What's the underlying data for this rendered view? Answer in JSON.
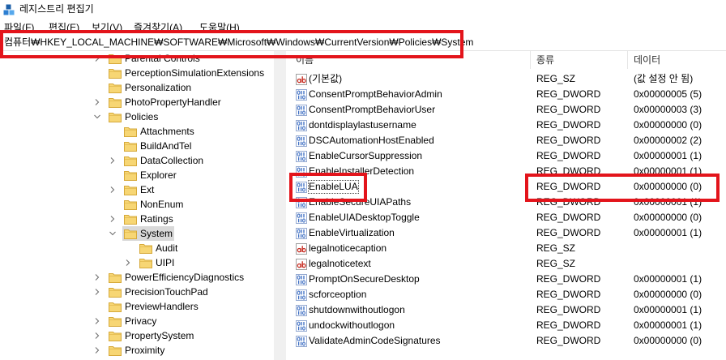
{
  "window": {
    "title": "레지스트리 편집기",
    "icon": "regedit-icon"
  },
  "menu": {
    "items": [
      "파일(F)",
      "편집(E)",
      "보기(V)",
      "즐겨찾기(A)",
      "도움말(H)"
    ]
  },
  "address_bar": {
    "path": "컴퓨터₩HKEY_LOCAL_MACHINE₩SOFTWARE₩Microsoft₩Windows₩CurrentVersion₩Policies₩System"
  },
  "tree": {
    "items": [
      {
        "label": "Parental Controls",
        "expandable": true
      },
      {
        "label": "PerceptionSimulationExtensions"
      },
      {
        "label": "Personalization"
      },
      {
        "label": "PhotoPropertyHandler",
        "expandable": true
      },
      {
        "label": "Policies",
        "expandable": true,
        "expanded": true,
        "children": [
          {
            "label": "Attachments"
          },
          {
            "label": "BuildAndTel"
          },
          {
            "label": "DataCollection",
            "expandable": true
          },
          {
            "label": "Explorer"
          },
          {
            "label": "Ext",
            "expandable": true
          },
          {
            "label": "NonEnum"
          },
          {
            "label": "Ratings",
            "expandable": true
          },
          {
            "label": "System",
            "expandable": true,
            "expanded": true,
            "selected": true,
            "children": [
              {
                "label": "Audit"
              },
              {
                "label": "UIPI",
                "expandable": true
              }
            ]
          }
        ]
      },
      {
        "label": "PowerEfficiencyDiagnostics",
        "expandable": true
      },
      {
        "label": "PrecisionTouchPad",
        "expandable": true
      },
      {
        "label": "PreviewHandlers"
      },
      {
        "label": "Privacy",
        "expandable": true
      },
      {
        "label": "PropertySystem",
        "expandable": true
      },
      {
        "label": "Proximity",
        "expandable": true
      }
    ]
  },
  "values_list": {
    "columns": {
      "name": "이름",
      "type": "종류",
      "data": "데이터"
    },
    "rows": [
      {
        "name": "(기본값)",
        "type": "REG_SZ",
        "data": "(값 설정 안 됨)",
        "icon": "string-value-icon"
      },
      {
        "name": "ConsentPromptBehaviorAdmin",
        "type": "REG_DWORD",
        "data": "0x00000005 (5)",
        "icon": "dword-value-icon"
      },
      {
        "name": "ConsentPromptBehaviorUser",
        "type": "REG_DWORD",
        "data": "0x00000003 (3)",
        "icon": "dword-value-icon"
      },
      {
        "name": "dontdisplaylastusername",
        "type": "REG_DWORD",
        "data": "0x00000000 (0)",
        "icon": "dword-value-icon"
      },
      {
        "name": "DSCAutomationHostEnabled",
        "type": "REG_DWORD",
        "data": "0x00000002 (2)",
        "icon": "dword-value-icon"
      },
      {
        "name": "EnableCursorSuppression",
        "type": "REG_DWORD",
        "data": "0x00000001 (1)",
        "icon": "dword-value-icon"
      },
      {
        "name": "EnableInstallerDetection",
        "type": "REG_DWORD",
        "data": "0x00000001 (1)",
        "icon": "dword-value-icon"
      },
      {
        "name": "EnableLUA",
        "type": "REG_DWORD",
        "data": "0x00000000 (0)",
        "icon": "dword-value-icon",
        "focused": true
      },
      {
        "name": "EnableSecureUIAPaths",
        "type": "REG_DWORD",
        "data": "0x00000001 (1)",
        "icon": "dword-value-icon"
      },
      {
        "name": "EnableUIADesktopToggle",
        "type": "REG_DWORD",
        "data": "0x00000000 (0)",
        "icon": "dword-value-icon"
      },
      {
        "name": "EnableVirtualization",
        "type": "REG_DWORD",
        "data": "0x00000001 (1)",
        "icon": "dword-value-icon"
      },
      {
        "name": "legalnoticecaption",
        "type": "REG_SZ",
        "data": "",
        "icon": "string-value-icon"
      },
      {
        "name": "legalnoticetext",
        "type": "REG_SZ",
        "data": "",
        "icon": "string-value-icon"
      },
      {
        "name": "PromptOnSecureDesktop",
        "type": "REG_DWORD",
        "data": "0x00000001 (1)",
        "icon": "dword-value-icon"
      },
      {
        "name": "scforceoption",
        "type": "REG_DWORD",
        "data": "0x00000000 (0)",
        "icon": "dword-value-icon"
      },
      {
        "name": "shutdownwithoutlogon",
        "type": "REG_DWORD",
        "data": "0x00000001 (1)",
        "icon": "dword-value-icon"
      },
      {
        "name": "undockwithoutlogon",
        "type": "REG_DWORD",
        "data": "0x00000001 (1)",
        "icon": "dword-value-icon"
      },
      {
        "name": "ValidateAdminCodeSignatures",
        "type": "REG_DWORD",
        "data": "0x00000000 (0)",
        "icon": "dword-value-icon"
      }
    ]
  },
  "colors": {
    "annotation": "#e3141b",
    "selection": "#d9d9d9",
    "scrollbar_track": "#f0f0f0",
    "folder": "#f7d674",
    "folder_edge": "#d6a93a",
    "dword_icon": "#3a6cc2",
    "string_icon": "#c62a1f",
    "chevron": "#707070",
    "app_icon_dark": "#1c5fa8",
    "app_icon_mid": "#2d7fd2",
    "app_icon_light": "#56a8ec"
  }
}
